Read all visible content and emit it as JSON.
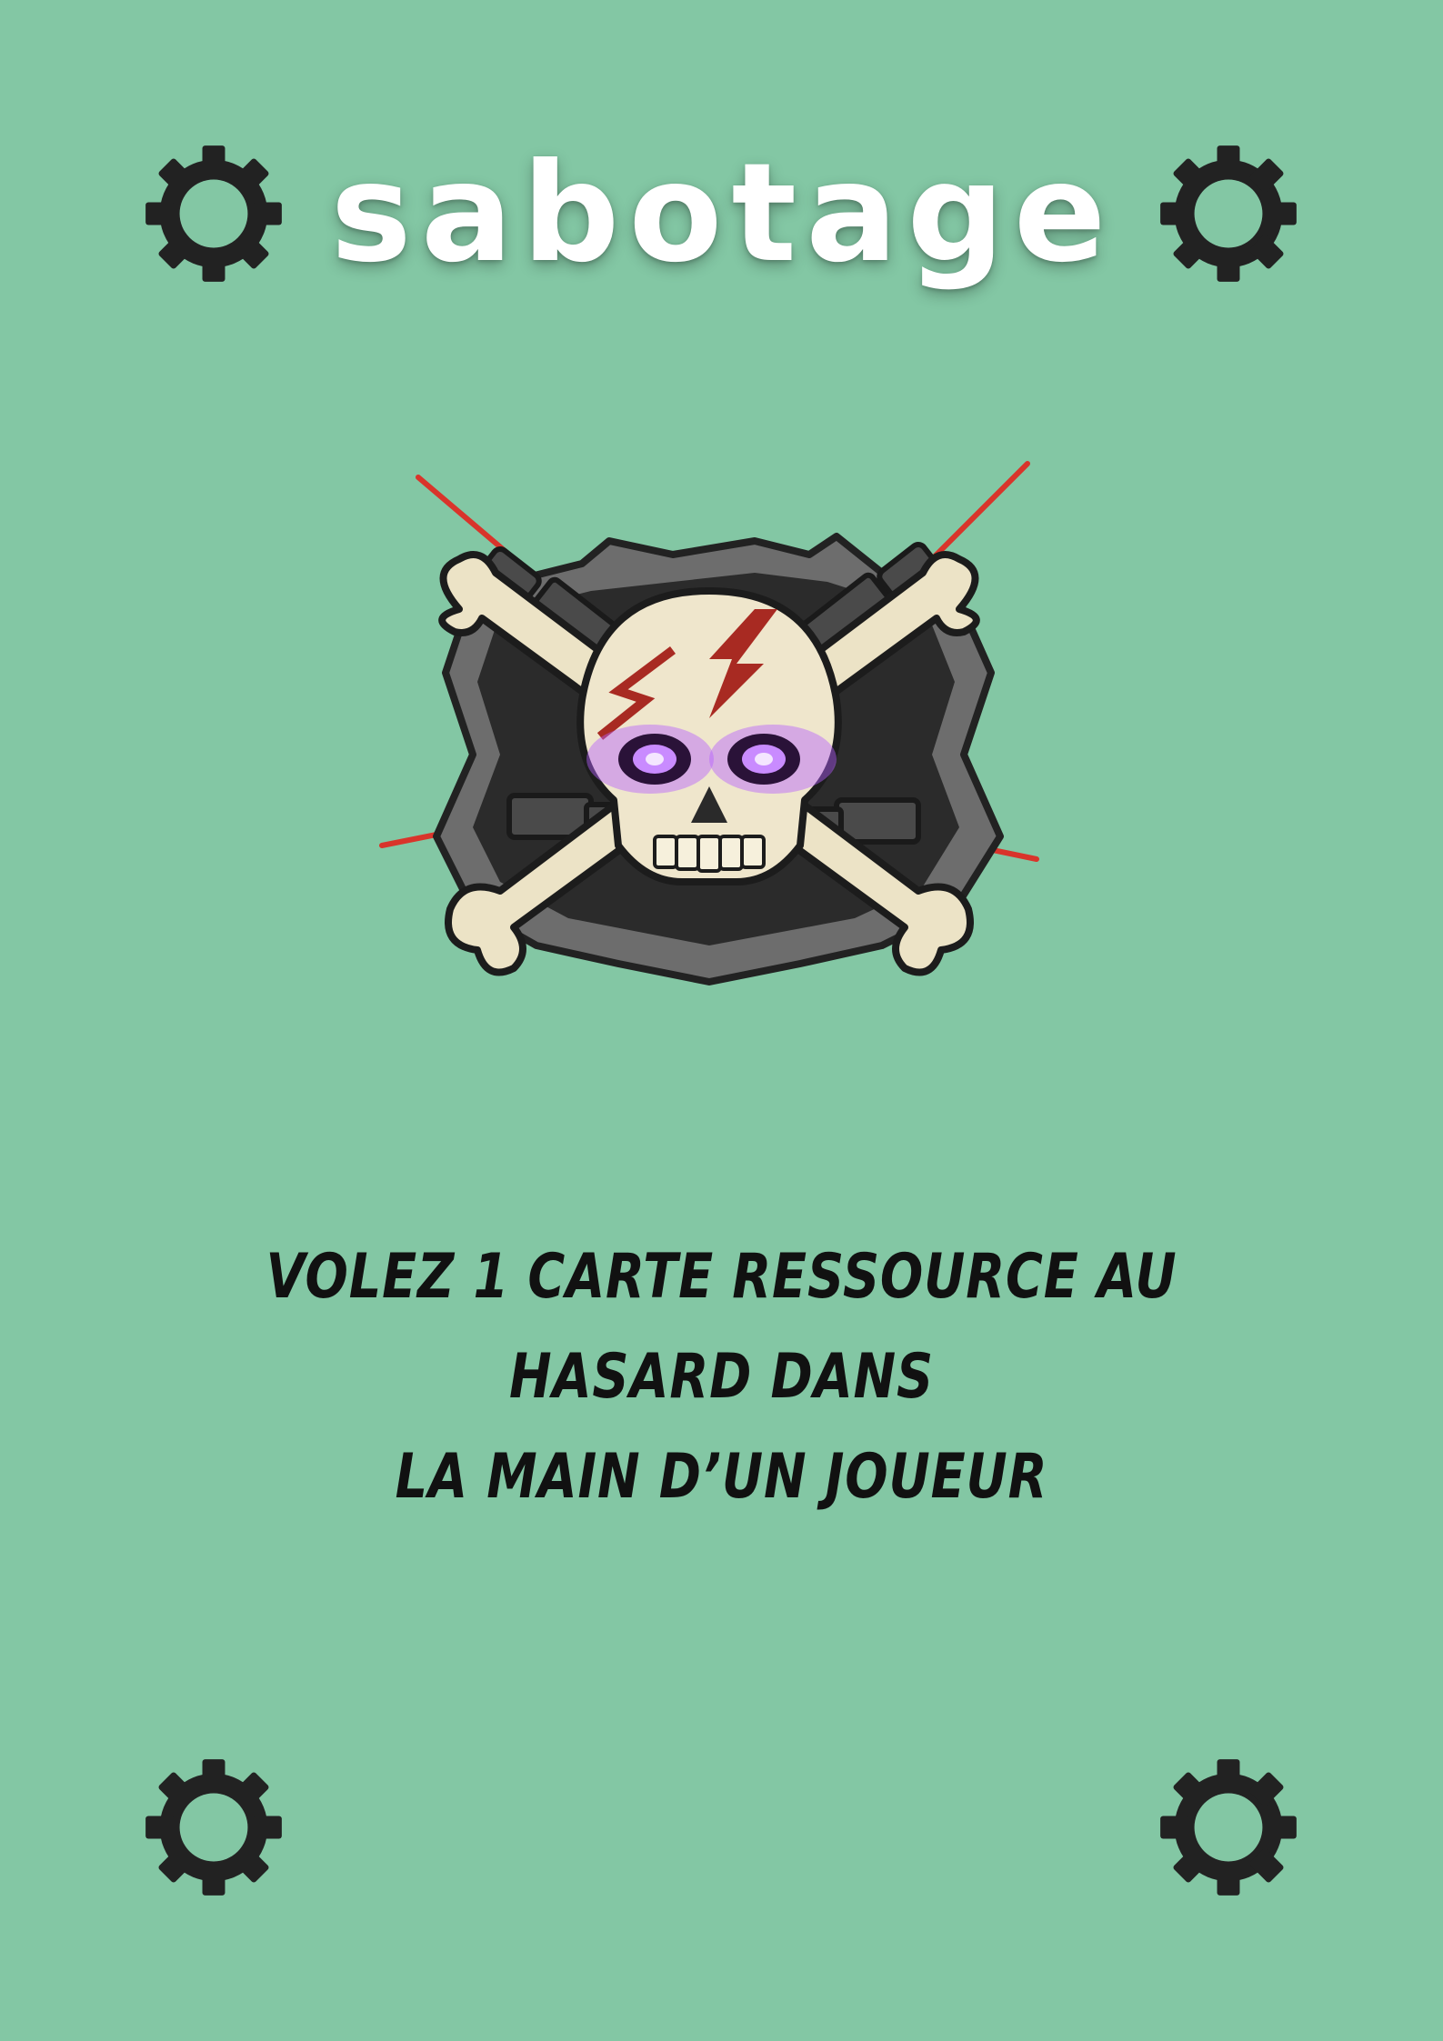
{
  "card": {
    "title": "SABOTAGE",
    "illustration": "skull-crossbones-icon",
    "effect_line1": "VOLEZ 1 CARTE RESSOURCE AU HASARD DANS",
    "effect_line2": "LA MAIN D’UN JOUEUR"
  },
  "decor": {
    "corner_icons": [
      "gear-icon",
      "gear-icon",
      "gear-icon",
      "gear-icon"
    ]
  },
  "colors": {
    "background": "#83c7a4",
    "title": "#ffffff",
    "text": "#111111",
    "gear": "#222222",
    "eyes": "#a23cf5",
    "accent": "#c0392b"
  }
}
